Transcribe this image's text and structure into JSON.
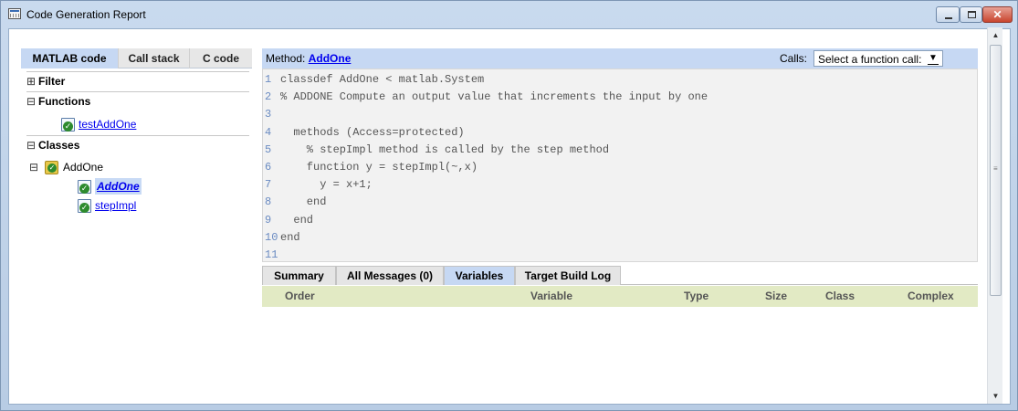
{
  "window": {
    "title": "Code Generation Report",
    "min_label": "",
    "max_label": "",
    "close_label": "✕"
  },
  "left": {
    "tabs": [
      "MATLAB code",
      "Call stack",
      "C code"
    ],
    "active_tab": "MATLAB code",
    "sections": {
      "filter": {
        "toggle": "⊞",
        "label": "Filter"
      },
      "functions": {
        "toggle": "⊟",
        "label": "Functions"
      },
      "classes": {
        "toggle": "⊟",
        "label": "Classes"
      }
    },
    "functions": [
      "testAddOne"
    ],
    "classes": {
      "toggle": "⊟",
      "name": "AddOne",
      "methods": [
        "AddOne",
        "stepImpl"
      ],
      "selected_method": "AddOne"
    }
  },
  "editor": {
    "method_label": "Method:",
    "method_name": "AddOne",
    "calls_label": "Calls:",
    "calls_select": "Select a function call:",
    "code_lines": [
      {
        "n": "1",
        "text": "classdef AddOne < matlab.System"
      },
      {
        "n": "2",
        "text": "% ADDONE Compute an output value that increments the input by one"
      },
      {
        "n": "3",
        "text": ""
      },
      {
        "n": "4",
        "text": "  methods (Access=protected)"
      },
      {
        "n": "5",
        "text": "    % stepImpl method is called by the step method"
      },
      {
        "n": "6",
        "text": "    function y = stepImpl(~,x)"
      },
      {
        "n": "7",
        "text": "      y = x+1;"
      },
      {
        "n": "8",
        "text": "    end"
      },
      {
        "n": "9",
        "text": "  end"
      },
      {
        "n": "10",
        "text": "end"
      },
      {
        "n": "11",
        "text": ""
      }
    ]
  },
  "bottom": {
    "tabs": [
      "Summary",
      "All Messages (0)",
      "Variables",
      "Target Build Log"
    ],
    "active_tab": "Variables",
    "columns": [
      "Order",
      "Variable",
      "Type",
      "Size",
      "Class",
      "Complex"
    ]
  },
  "colors": {
    "tab_active": "#c6d8f3",
    "table_header": "#e2eac4",
    "code_bg": "#f2f2f2",
    "link": "#0000ee"
  }
}
